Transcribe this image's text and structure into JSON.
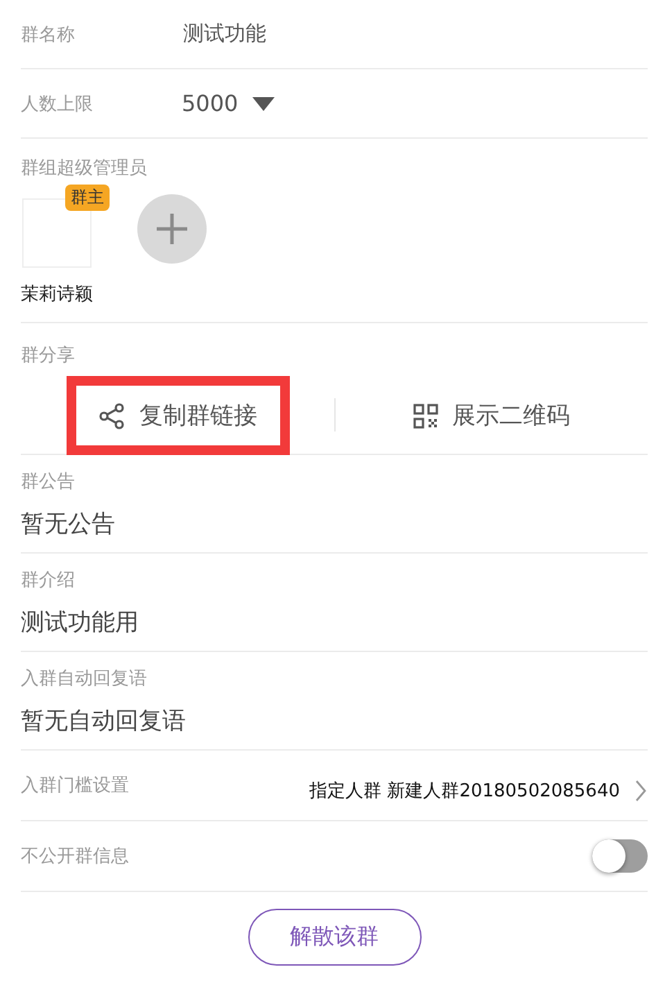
{
  "name_row": {
    "label": "群名称",
    "value": "测试功能"
  },
  "limit_row": {
    "label": "人数上限",
    "value": "5000"
  },
  "admins": {
    "label": "群组超级管理员",
    "members": [
      {
        "name": "茉莉诗颖",
        "badge": "群主"
      }
    ]
  },
  "share": {
    "label": "群分享",
    "options": [
      {
        "kind": "link",
        "label": "复制群链接",
        "highlighted": true
      },
      {
        "kind": "qr",
        "label": "展示二维码",
        "highlighted": false
      }
    ]
  },
  "text_rows": [
    {
      "label": "群公告",
      "value": "暂无公告"
    },
    {
      "label": "群介绍",
      "value": "测试功能用"
    },
    {
      "label": "入群自动回复语",
      "value": "暂无自动回复语"
    }
  ],
  "threshold": {
    "label": "入群门槛设置",
    "value": "指定人群 新建人群20180502085640"
  },
  "private": {
    "label": "不公开群信息",
    "on": false
  },
  "dissolve_button": "解散该群"
}
